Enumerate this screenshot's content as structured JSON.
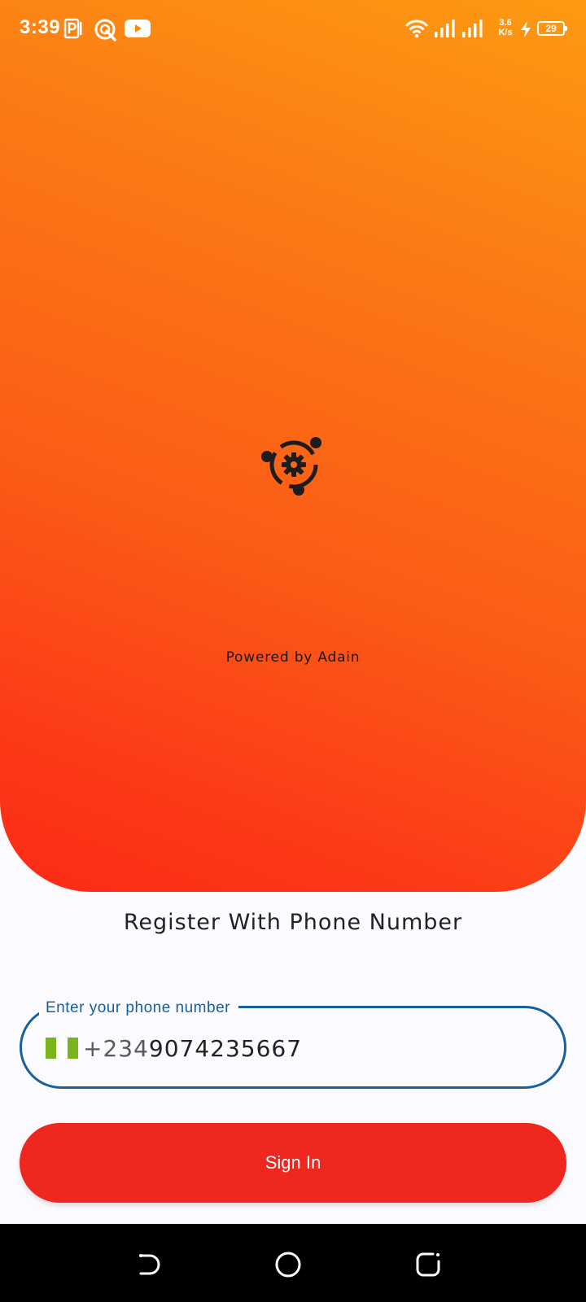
{
  "status_bar": {
    "time": "3:39",
    "net_speed_value": "3.6",
    "net_speed_unit": "K/s",
    "battery_level": "29",
    "icons": [
      "parking-icon",
      "q-app-icon",
      "youtube-icon",
      "wifi-icon",
      "signal-icon",
      "signal-icon",
      "charging-icon",
      "battery-icon"
    ]
  },
  "hero": {
    "logo_icon": "gear-network-icon",
    "powered_by": "Powered by Adain",
    "gradient_colors": [
      "#fd9a12",
      "#fc2a17"
    ]
  },
  "form": {
    "title": "Register With Phone Number",
    "phone_label": "Enter your phone number",
    "country_code": "+234",
    "phone_number": "9074235667",
    "flag_colors": [
      "#7ab51d",
      "#ffffff",
      "#7ab51d"
    ],
    "sign_in_label": "Sign In",
    "accent_color": "#17609d",
    "button_color": "#ee281f"
  },
  "nav_bar": {
    "icons": [
      "back-icon",
      "home-icon",
      "recents-icon"
    ]
  }
}
